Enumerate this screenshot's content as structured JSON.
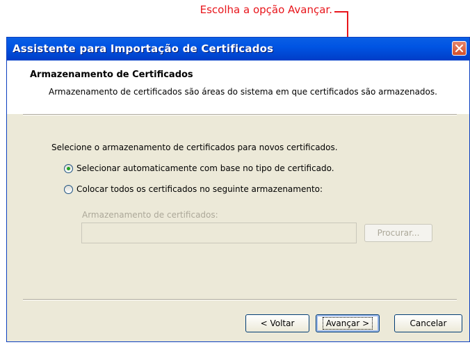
{
  "annotation": {
    "text": "Escolha a opção Avançar."
  },
  "window": {
    "title": "Assistente para Importação de Certificados"
  },
  "header": {
    "title": "Armazenamento de Certificados",
    "description": "Armazenamento de certificados são áreas do sistema em que certificados são armazenados."
  },
  "body": {
    "prompt": "Selecione o armazenamento de certificados para novos certificados.",
    "options": [
      {
        "label": "Selecionar automaticamente com base no tipo de certificado.",
        "selected": true
      },
      {
        "label": "Colocar todos os certificados no seguinte armazenamento:",
        "selected": false
      }
    ],
    "store_label": "Armazenamento de certificados:",
    "store_value": "",
    "browse_label": "Procurar..."
  },
  "footer": {
    "back_label": "< Voltar",
    "next_label": "Avançar >",
    "cancel_label": "Cancelar"
  },
  "colors": {
    "accent": "#0054e3",
    "annotation": "#e8151b"
  }
}
